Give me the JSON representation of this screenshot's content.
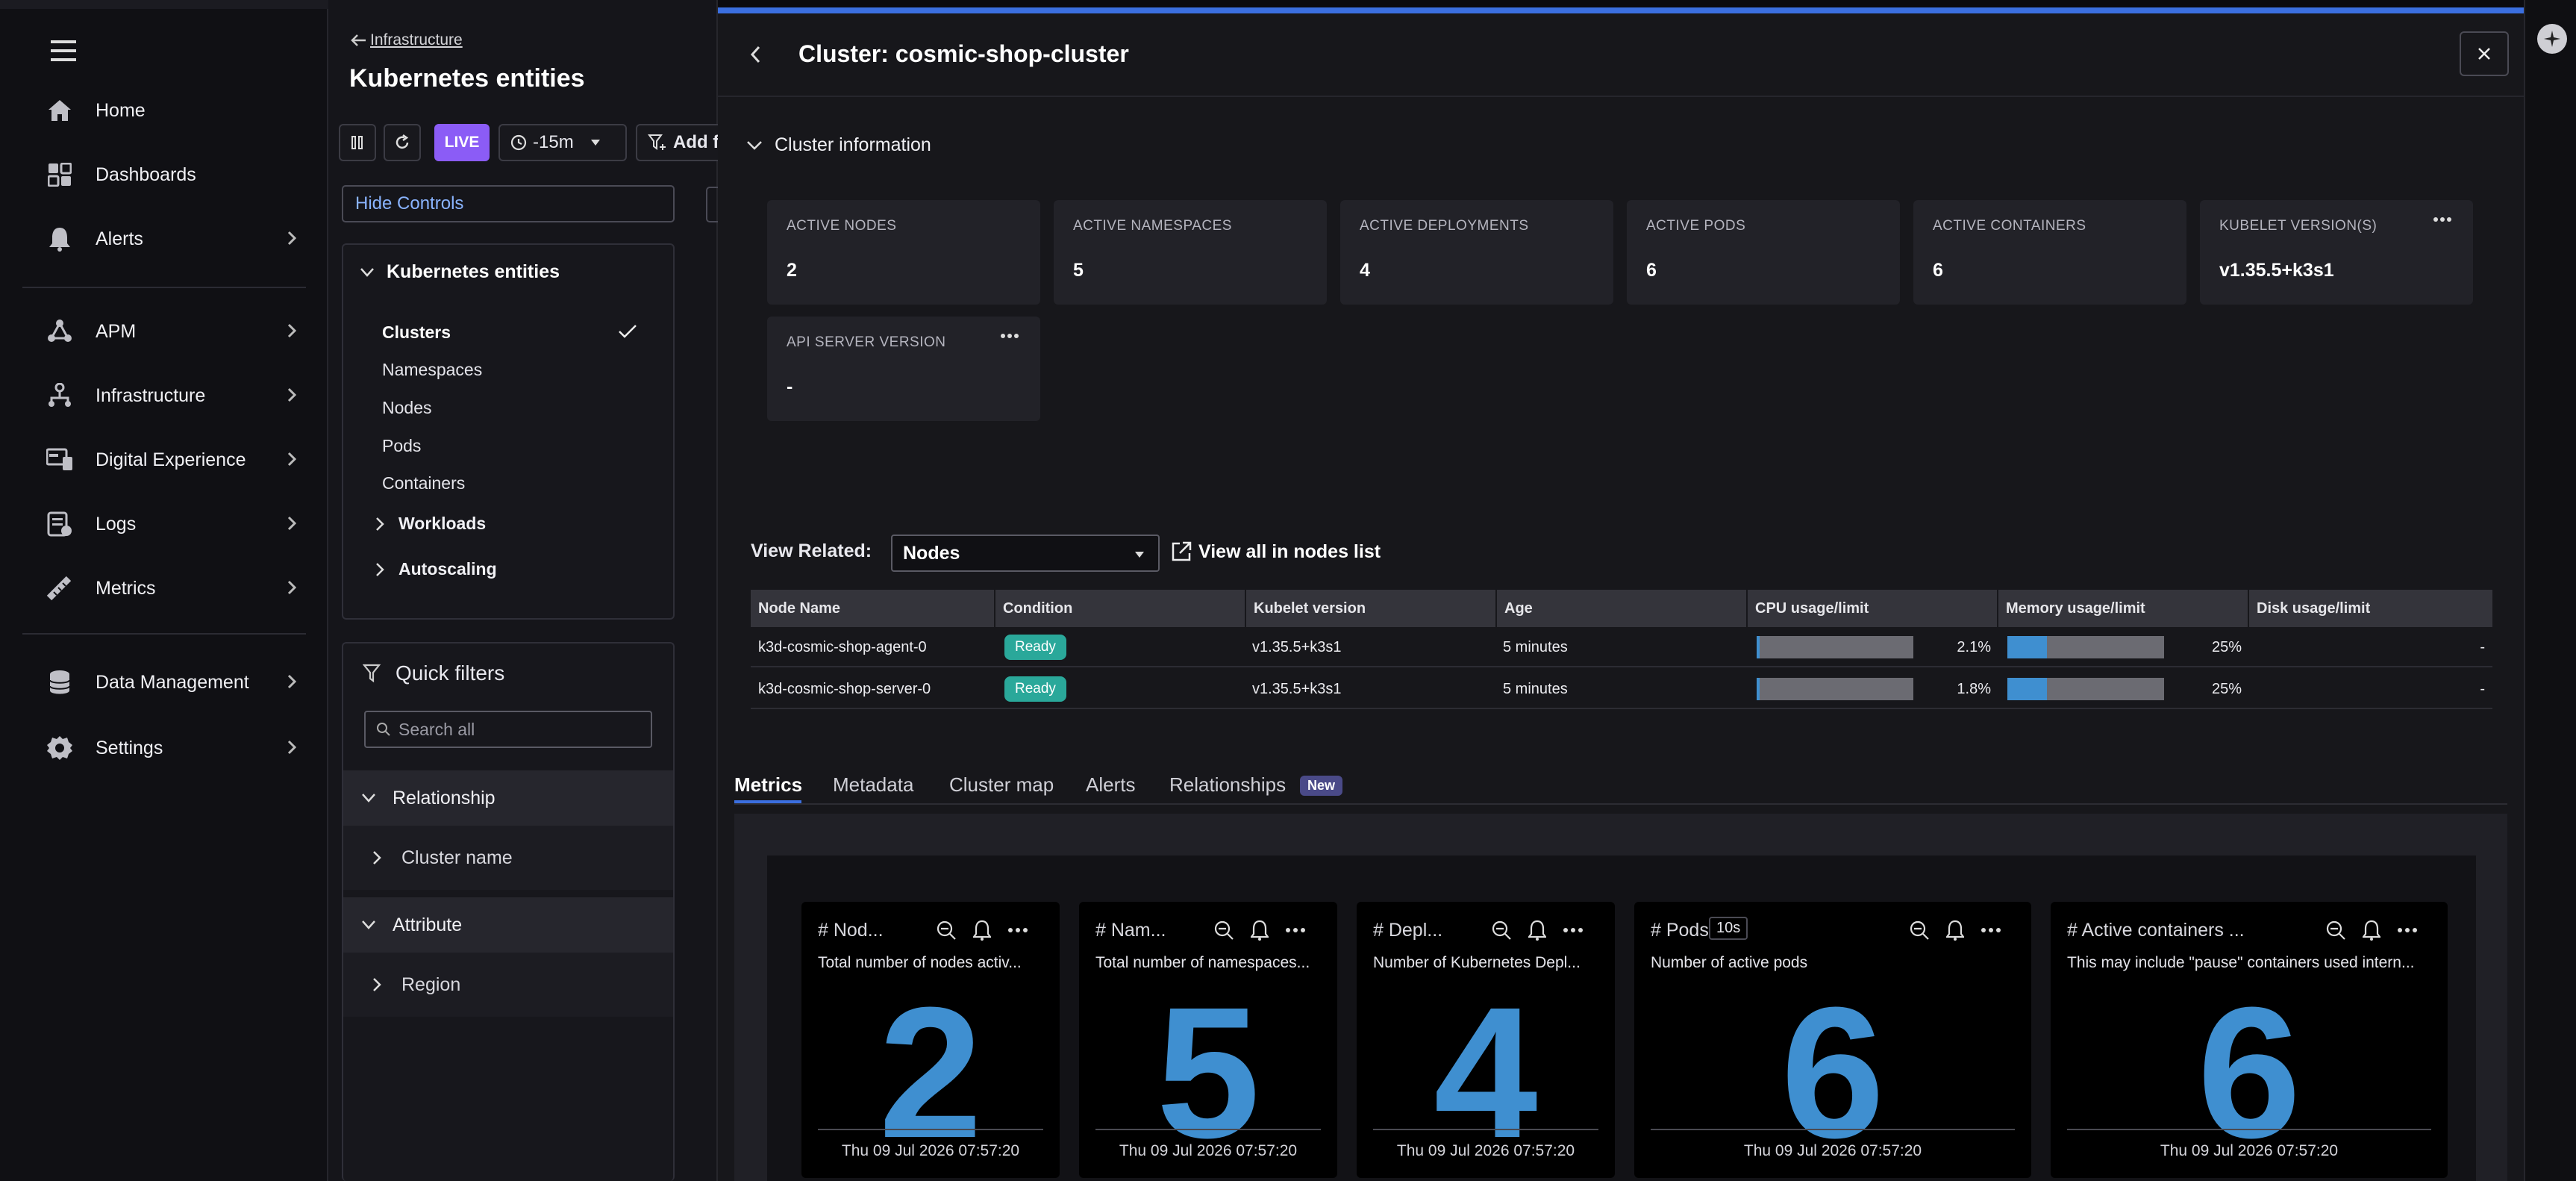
{
  "nav": {
    "items": [
      {
        "label": "Home",
        "icon": "home-icon"
      },
      {
        "label": "Dashboards",
        "icon": "dashboards-icon"
      },
      {
        "label": "Alerts",
        "icon": "bell-icon"
      },
      {
        "label": "APM",
        "icon": "apm-icon"
      },
      {
        "label": "Infrastructure",
        "icon": "infrastructure-icon"
      },
      {
        "label": "Digital Experience",
        "icon": "digital-experience-icon"
      },
      {
        "label": "Logs",
        "icon": "logs-icon"
      },
      {
        "label": "Metrics",
        "icon": "metrics-icon"
      },
      {
        "label": "Data Management",
        "icon": "database-icon"
      },
      {
        "label": "Settings",
        "icon": "gear-icon"
      }
    ]
  },
  "entities": {
    "breadcrumb": "Infrastructure",
    "title": "Kubernetes entities",
    "live_label": "LIVE",
    "time_label": "-15m",
    "add_filter_label": "Add f",
    "hide_controls": "Hide Controls",
    "panel_title": "Kubernetes entities",
    "items": [
      "Clusters",
      "Namespaces",
      "Nodes",
      "Pods",
      "Containers"
    ],
    "groups": [
      "Workloads",
      "Autoscaling"
    ],
    "quick_filters_title": "Quick filters",
    "search_placeholder": "Search all",
    "relationship_label": "Relationship",
    "cluster_name_label": "Cluster name",
    "attribute_label": "Attribute",
    "region_label": "Region"
  },
  "detail": {
    "title": "Cluster: cosmic-shop-cluster",
    "section_title": "Cluster information",
    "cards": [
      {
        "label": "ACTIVE NODES",
        "value": "2"
      },
      {
        "label": "ACTIVE NAMESPACES",
        "value": "5"
      },
      {
        "label": "ACTIVE DEPLOYMENTS",
        "value": "4"
      },
      {
        "label": "ACTIVE PODS",
        "value": "6"
      },
      {
        "label": "ACTIVE CONTAINERS",
        "value": "6"
      },
      {
        "label": "KUBELET VERSION(S)",
        "value": "v1.35.5+k3s1"
      },
      {
        "label": "API SERVER VERSION",
        "value": "-"
      }
    ],
    "view_related_label": "View Related:",
    "view_related_value": "Nodes",
    "view_all_label": "View all in nodes list",
    "table": {
      "headers": [
        "Node Name",
        "Condition",
        "Kubelet version",
        "Age",
        "CPU usage/limit",
        "Memory usage/limit",
        "Disk usage/limit"
      ],
      "rows": [
        {
          "name": "k3d-cosmic-shop-agent-0",
          "condition": "Ready",
          "kubelet": "v1.35.5+k3s1",
          "age": "5 minutes",
          "cpu": "2.1%",
          "cpu_frac": 0.021,
          "mem": "25%",
          "mem_frac": 0.25,
          "disk": "-"
        },
        {
          "name": "k3d-cosmic-shop-server-0",
          "condition": "Ready",
          "kubelet": "v1.35.5+k3s1",
          "age": "5 minutes",
          "cpu": "1.8%",
          "cpu_frac": 0.018,
          "mem": "25%",
          "mem_frac": 0.25,
          "disk": "-"
        }
      ]
    },
    "tabs": [
      "Metrics",
      "Metadata",
      "Cluster map",
      "Alerts",
      "Relationships"
    ],
    "new_badge": "New",
    "metrics": [
      {
        "title": "# Nod...",
        "desc": "Total number of nodes activ...",
        "value": "2",
        "timestamp": "Thu 09 Jul 2026 07:57:20"
      },
      {
        "title": "# Nam...",
        "desc": "Total number of namespaces...",
        "value": "5",
        "timestamp": "Thu 09 Jul 2026 07:57:20"
      },
      {
        "title": "# Depl...",
        "desc": "Number of Kubernetes Depl...",
        "value": "4",
        "timestamp": "Thu 09 Jul 2026 07:57:20"
      },
      {
        "title": "# Pods",
        "badge": "10s",
        "desc": "Number of active pods",
        "value": "6",
        "timestamp": "Thu 09 Jul 2026 07:57:20"
      },
      {
        "title": "# Active containers ...",
        "desc": "This may include \"pause\" containers used intern...",
        "value": "6",
        "timestamp": "Thu 09 Jul 2026 07:57:20"
      }
    ],
    "colors": {
      "accent": "#3b6fe0",
      "metric_value": "#3f8fd0",
      "ready": "#2aa89a",
      "live": "#8b5cf6"
    }
  }
}
